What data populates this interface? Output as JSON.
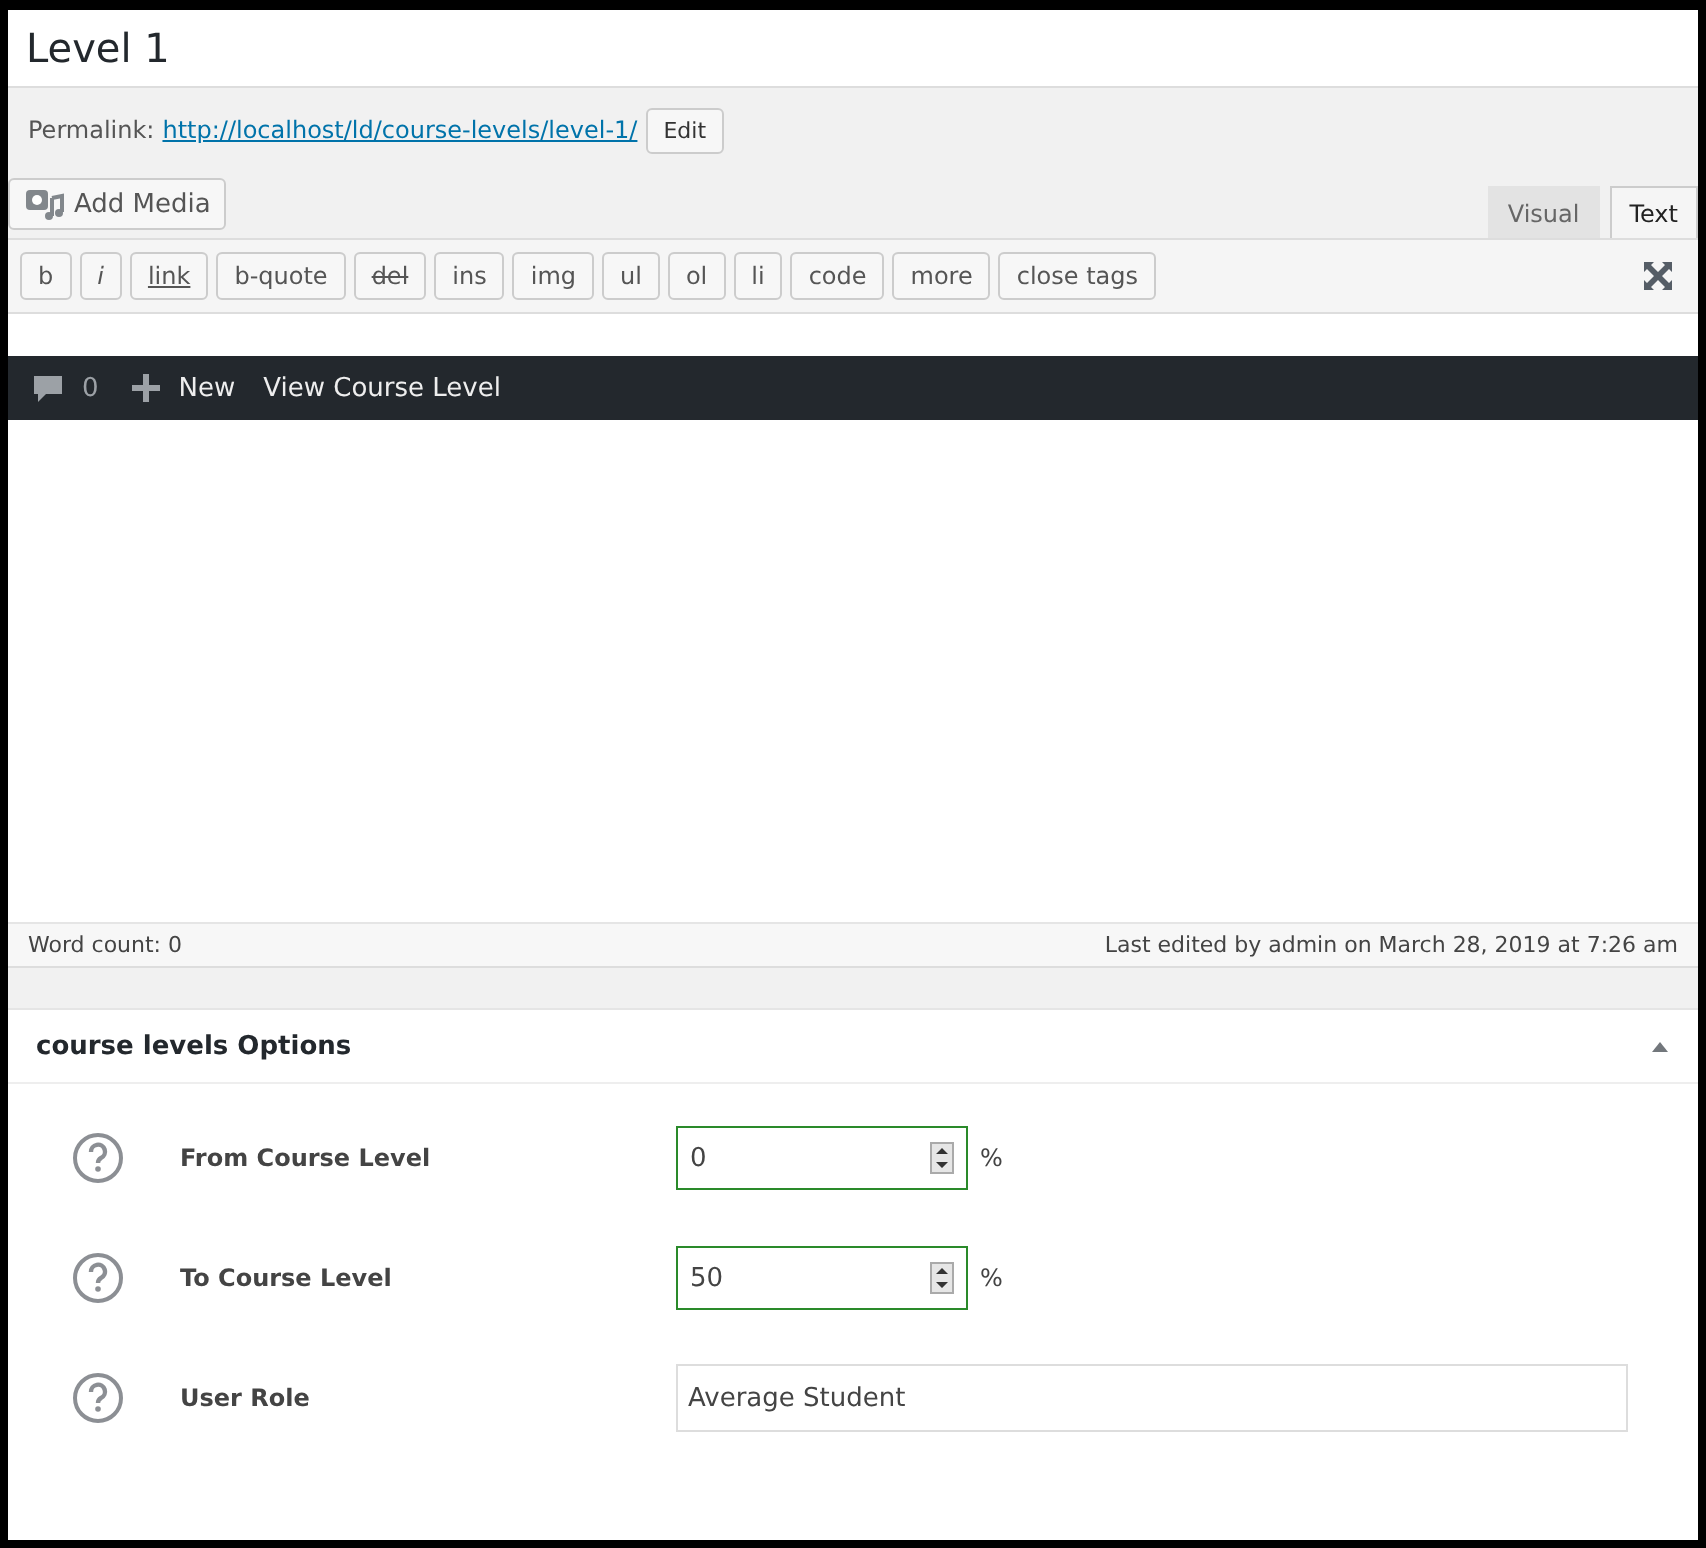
{
  "title_field": {
    "value": "Level 1"
  },
  "permalink": {
    "label": "Permalink:",
    "url": "http://localhost/ld/course-levels/level-1/",
    "edit_button": "Edit"
  },
  "add_media_button": "Add Media",
  "editor_tabs": [
    {
      "label": "Visual",
      "selected": false
    },
    {
      "label": "Text",
      "selected": true
    }
  ],
  "quicktags": [
    {
      "label": "b",
      "kind": "plain"
    },
    {
      "label": "i",
      "kind": "italic"
    },
    {
      "label": "link",
      "kind": "underline"
    },
    {
      "label": "b-quote",
      "kind": "plain"
    },
    {
      "label": "del",
      "kind": "strike"
    },
    {
      "label": "ins",
      "kind": "plain"
    },
    {
      "label": "img",
      "kind": "plain"
    },
    {
      "label": "ul",
      "kind": "plain"
    },
    {
      "label": "ol",
      "kind": "plain"
    },
    {
      "label": "li",
      "kind": "plain"
    },
    {
      "label": "code",
      "kind": "plain"
    },
    {
      "label": "more",
      "kind": "plain"
    },
    {
      "label": "close tags",
      "kind": "plain"
    }
  ],
  "admin_bar": {
    "comment_count": "0",
    "new_label": "New",
    "view_label": "View Course Level"
  },
  "status_bar": {
    "word_count": "Word count: 0",
    "last_edited": "Last edited by admin on March 28, 2019 at 7:26 am"
  },
  "metabox": {
    "title": "course levels Options",
    "expanded": true,
    "fields": [
      {
        "label": "From Course Level",
        "kind": "number",
        "value": "0",
        "unit": "%"
      },
      {
        "label": "To Course Level",
        "kind": "number",
        "value": "50",
        "unit": "%"
      },
      {
        "label": "User Role",
        "kind": "text",
        "value": "Average Student"
      }
    ]
  }
}
